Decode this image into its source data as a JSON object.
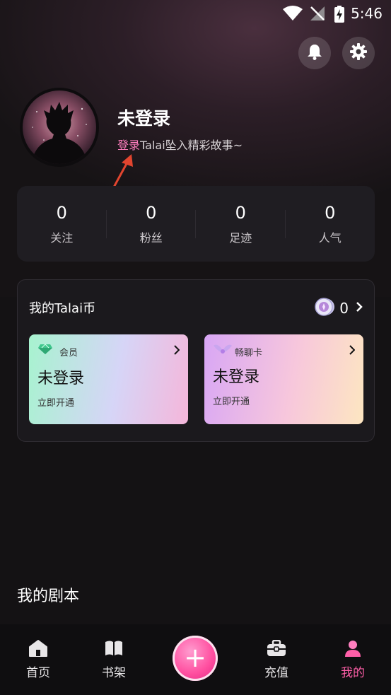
{
  "status_bar": {
    "time": "5:46"
  },
  "profile": {
    "username": "未登录",
    "subtitle_link": "登录",
    "subtitle_text": "Talai坠入精彩故事~"
  },
  "stats": [
    {
      "value": "0",
      "label": "关注"
    },
    {
      "value": "0",
      "label": "粉丝"
    },
    {
      "value": "0",
      "label": "足迹"
    },
    {
      "value": "0",
      "label": "人气"
    }
  ],
  "coins": {
    "title": "我的Talai币",
    "count": "0"
  },
  "membership_cards": [
    {
      "label": "会员",
      "title": "未登录",
      "cta": "立即开通"
    },
    {
      "label": "畅聊卡",
      "title": "未登录",
      "cta": "立即开通"
    }
  ],
  "scripts_section": {
    "title": "我的剧本"
  },
  "bottom_nav": {
    "items": [
      {
        "label": "首页"
      },
      {
        "label": "书架"
      },
      {
        "label": "充值"
      },
      {
        "label": "我的"
      }
    ],
    "active": "我的"
  },
  "colors": {
    "accent_pink": "#ff5fa8",
    "login_link": "#ff7fbf",
    "background": "#141214"
  }
}
